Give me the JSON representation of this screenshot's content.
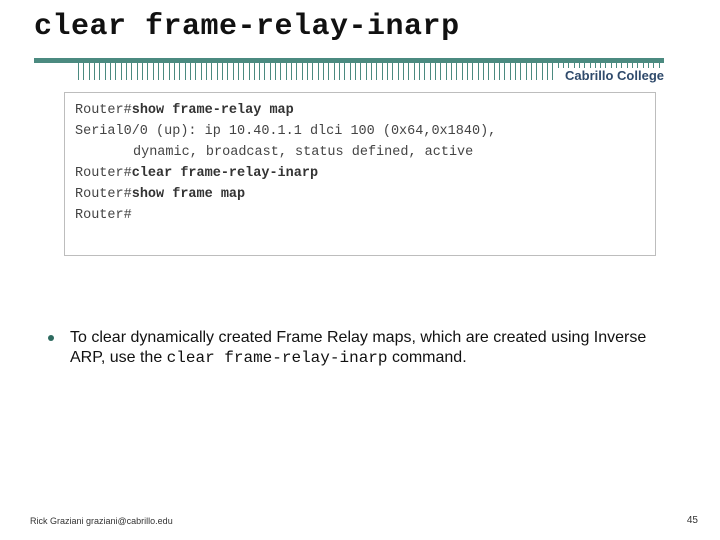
{
  "title": "clear frame-relay-inarp",
  "brand": "Cabrillo College",
  "terminal": {
    "l1_prompt": "Router#",
    "l1_cmd": "show frame-relay map",
    "l2": "Serial0/0 (up): ip 10.40.1.1 dlci 100 (0x64,0x1840),",
    "l3": "dynamic, broadcast, status defined, active",
    "l4_prompt": "Router#",
    "l4_cmd": "clear frame-relay-inarp",
    "l5_prompt": "Router#",
    "l5_cmd": "show frame map",
    "l6": "Router#"
  },
  "bullet": {
    "pre": "To clear dynamically created Frame Relay maps, which are created using Inverse ARP, use the ",
    "cmd": "clear frame-relay-inarp",
    "post": " command."
  },
  "footer": "Rick Graziani  graziani@cabrillo.edu",
  "page": "45"
}
